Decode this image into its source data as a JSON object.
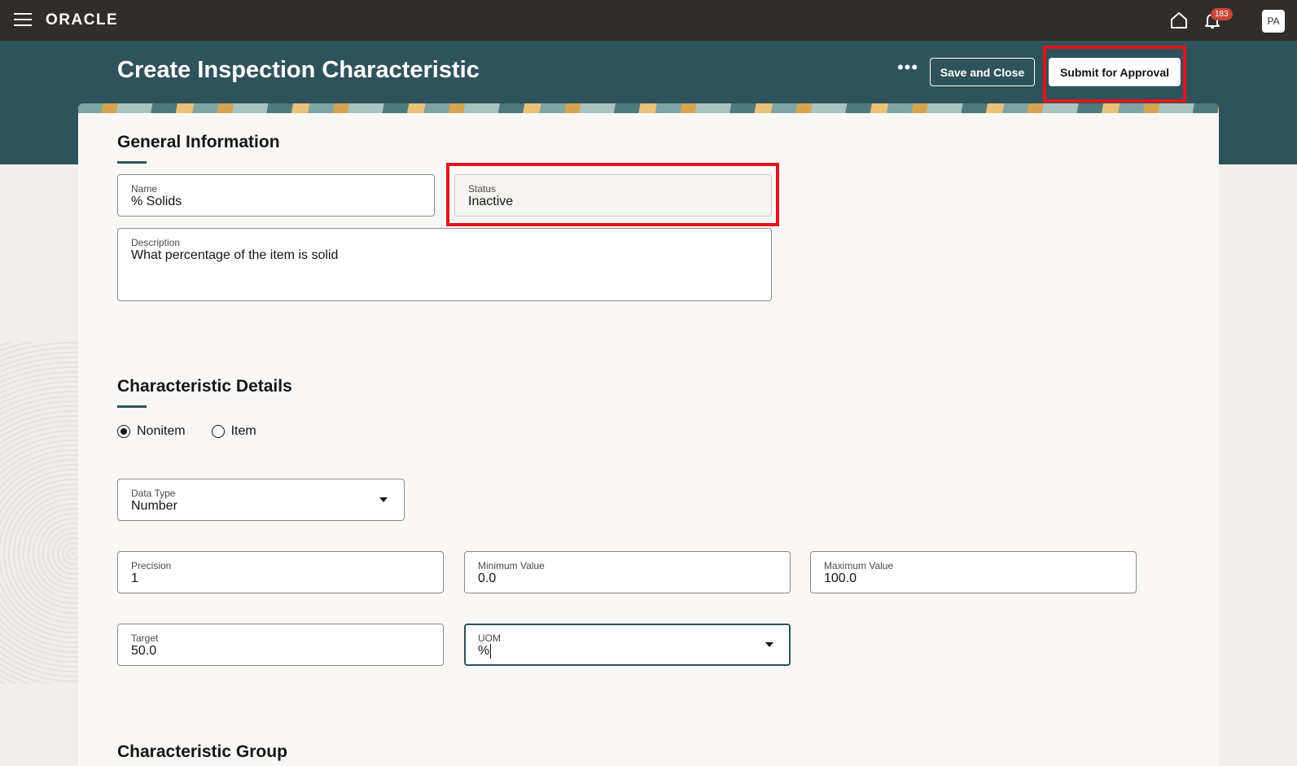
{
  "topbar": {
    "logo": "ORACLE",
    "notification_count": "183",
    "avatar_initials": "PA"
  },
  "header": {
    "title": "Create Inspection Characteristic",
    "more_label": "•••",
    "save_close_label": "Save and Close",
    "submit_label": "Submit for Approval"
  },
  "general": {
    "title": "General Information",
    "name_label": "Name",
    "name_value": "% Solids",
    "status_label": "Status",
    "status_value": "Inactive",
    "description_label": "Description",
    "description_value": "What percentage of the item is solid"
  },
  "details": {
    "title": "Characteristic Details",
    "radio_nonitem": "Nonitem",
    "radio_item": "Item",
    "selected": "Nonitem",
    "data_type_label": "Data Type",
    "data_type_value": "Number",
    "precision_label": "Precision",
    "precision_value": "1",
    "min_label": "Minimum Value",
    "min_value": "0.0",
    "max_label": "Maximum Value",
    "max_value": "100.0",
    "target_label": "Target",
    "target_value": "50.0",
    "uom_label": "UOM",
    "uom_value": "%"
  },
  "group": {
    "title": "Characteristic Group"
  },
  "colors": {
    "topbar": "#312d2a",
    "header": "#2f535a",
    "highlight": "#e0141e",
    "badge": "#c74634"
  }
}
